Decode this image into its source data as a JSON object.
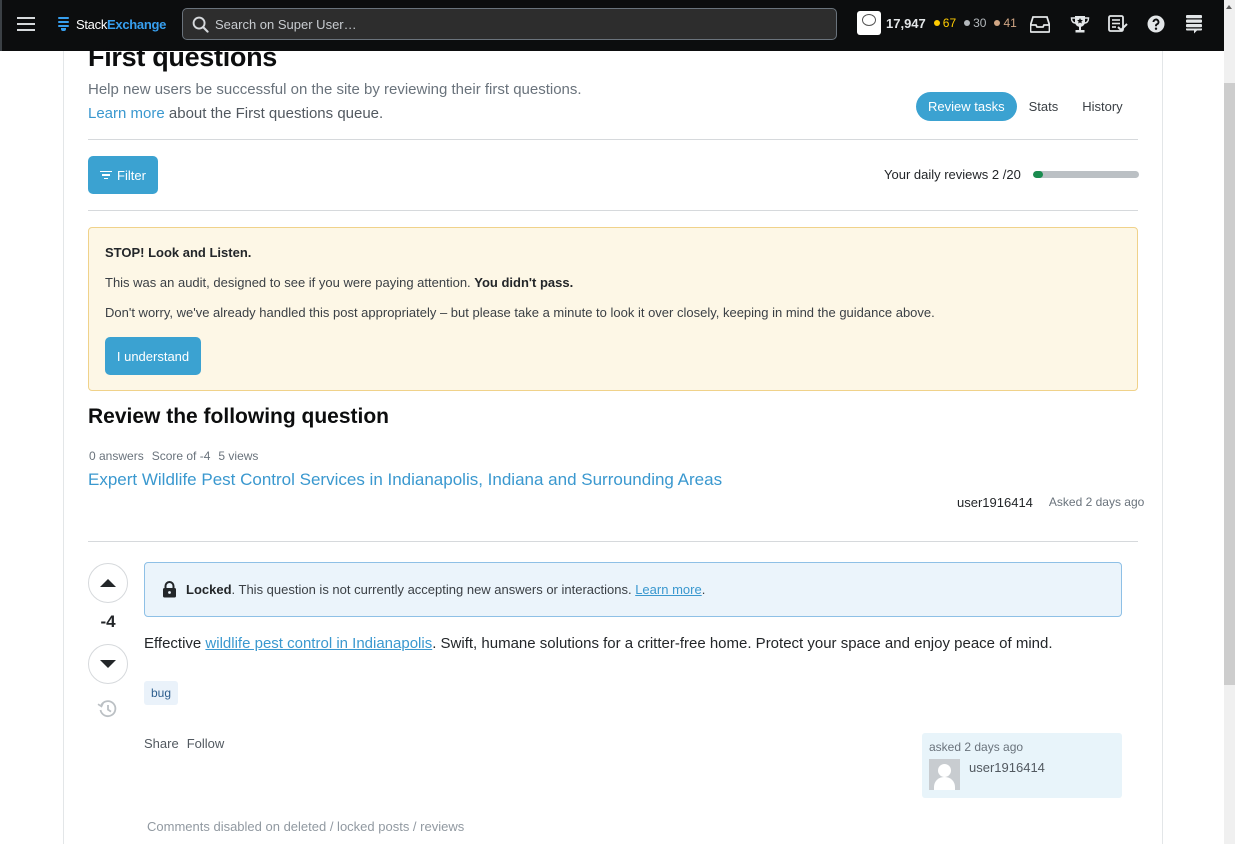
{
  "topbar": {
    "logo_part1": "Stack",
    "logo_part2": "Exchange",
    "search_placeholder": "Search on Super User…",
    "reputation": "17,947",
    "badges": {
      "gold": "67",
      "silver": "30",
      "bronze": "41"
    },
    "icons": [
      "inbox-icon",
      "achievements-icon",
      "review-queues-icon",
      "help-icon",
      "site-switcher-icon"
    ]
  },
  "header": {
    "title": "First questions",
    "subtitle": "Help new users be successful on the site by reviewing their first questions.",
    "learn_more_link": "Learn more",
    "learn_more_rest": " about the First questions queue.",
    "tabs": [
      {
        "label": "Review tasks",
        "active": true
      },
      {
        "label": "Stats",
        "active": false
      },
      {
        "label": "History",
        "active": false
      }
    ]
  },
  "toolbar": {
    "filter_label": "Filter",
    "daily_reviews_label": "Your daily reviews",
    "daily_reviews_value": "2 /20",
    "daily_reviews_done": 2,
    "daily_reviews_max": 20
  },
  "audit_notice": {
    "title": "STOP! Look and Listen.",
    "line1_text": "This was an audit, designed to see if you were paying attention. ",
    "line1_bold": "You didn't pass.",
    "line2": "Don't worry, we've already handled this post appropriately – but please take a minute to look it over closely, keeping in mind the guidance above.",
    "button_label": "I understand"
  },
  "review": {
    "heading": "Review the following question",
    "stats": {
      "answers": "0 answers",
      "score": "Score of -4",
      "views": "5 views"
    },
    "question_title": "Expert Wildlife Pest Control Services in Indianapolis, Indiana and Surrounding Areas",
    "owner": "user1916414",
    "asked": "Asked 2 days ago"
  },
  "post": {
    "score": "-4",
    "locked_label": "Locked",
    "locked_text": ". This question is not currently accepting new answers or interactions. ",
    "locked_link": "Learn more",
    "locked_end": ".",
    "body_prefix": "Effective ",
    "body_link": "wildlife pest control in Indianapolis",
    "body_suffix": ". Swift, humane solutions for a critter-free home. Protect your space and enjoy peace of mind.",
    "tags": [
      "bug"
    ],
    "menu": {
      "share": "Share",
      "follow": "Follow"
    },
    "signature": {
      "asked": "asked 2 days ago",
      "user": "user1916414"
    },
    "comments_disabled": "Comments disabled on deleted / locked posts / reviews"
  },
  "colors": {
    "accent": "#3ba2d1",
    "link": "#3a98cf",
    "progress_fill": "#1a8c4f",
    "notice_bg": "#fdf7e6",
    "notice_border": "#f0d28a",
    "locked_bg": "#ebf4fb",
    "topbar_bg": "#0c0d0e"
  }
}
